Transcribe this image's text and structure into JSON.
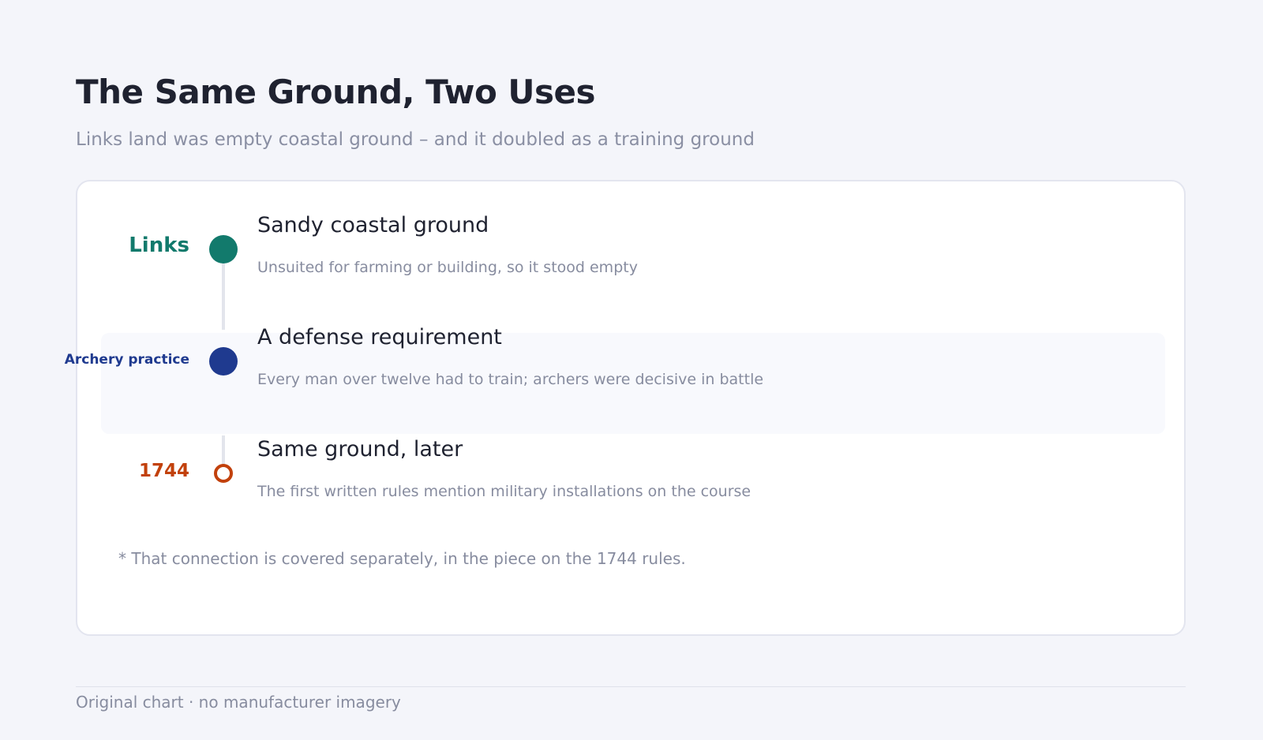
{
  "header": {
    "title": "The Same Ground, Two Uses",
    "subtitle": "Links land was empty coastal ground – and it doubled as a training ground"
  },
  "timeline": {
    "steps": [
      {
        "label": "Links",
        "title": "Sandy coastal ground",
        "description": "Unsuited for farming or building, so it stood empty",
        "color": "#127a6c",
        "marker": "filled-circle"
      },
      {
        "label": "Archery practice",
        "title": "A defense requirement",
        "description": "Every man over twelve had to train; archers were decisive in battle",
        "color": "#1f3a8f",
        "marker": "filled-circle",
        "highlighted": true
      },
      {
        "label": "1744",
        "title": "Same ground, later",
        "description": "The first written rules mention military installations on the course",
        "color": "#c2410c",
        "marker": "hollow-circle"
      }
    ],
    "footnote": "* That connection is covered separately, in the piece on the 1744 rules."
  },
  "footer": {
    "credit": "Original chart · no manufacturer imagery"
  }
}
